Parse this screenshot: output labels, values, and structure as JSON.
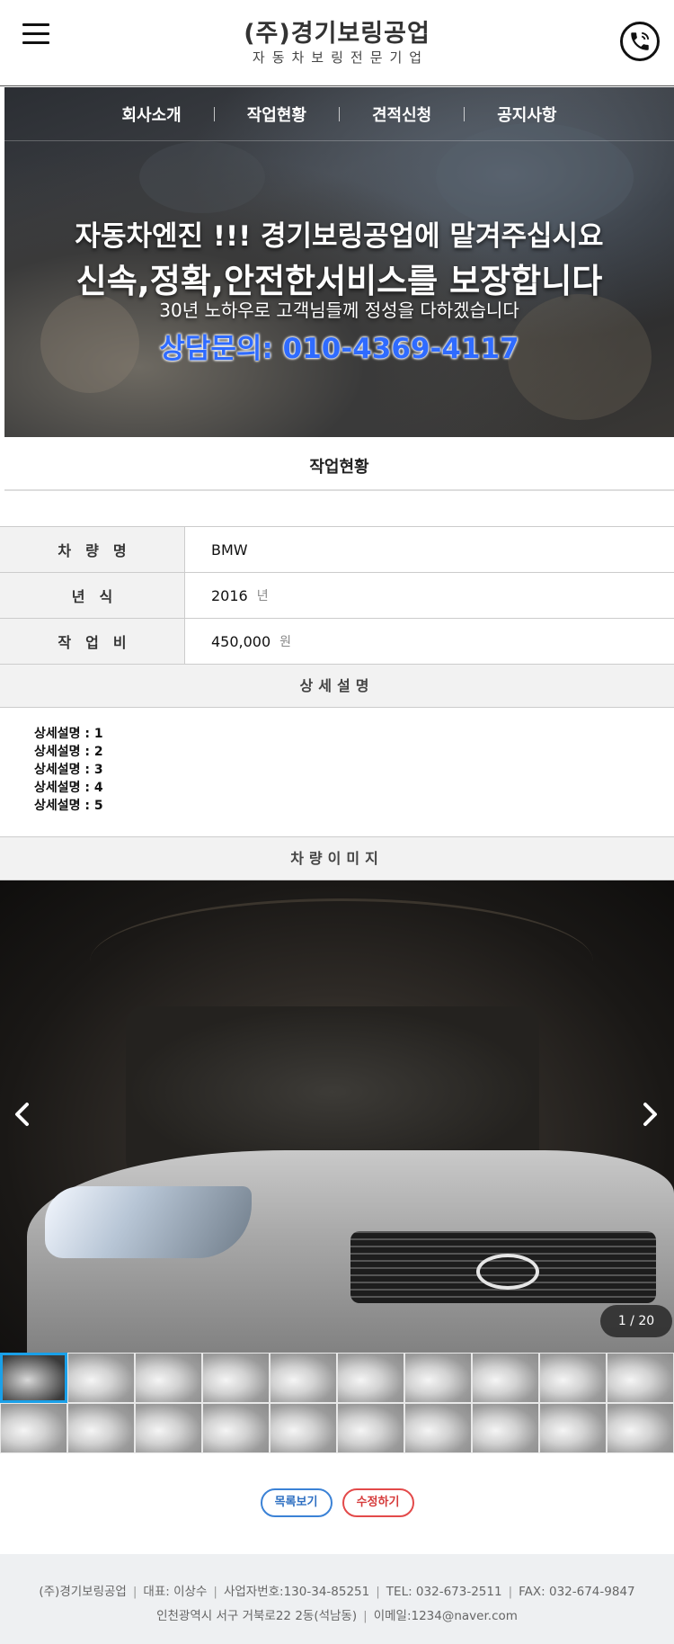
{
  "header": {
    "company": "(주)경기보링공업",
    "tagline": "자동차보링전문기업",
    "menu_icon": "hamburger-icon",
    "call_icon": "phone-call-icon"
  },
  "nav": {
    "items": [
      "회사소개",
      "작업현황",
      "견적신청",
      "공지사항"
    ]
  },
  "hero": {
    "line1": "자동차엔진 !!! 경기보링공업에 맡겨주십시요",
    "line2": "신속,정확,안전한서비스를 보장합니다",
    "line3": "30년 노하우로 고객님들께 정성을 다하겠습니다",
    "contact": "상담문의: 010-4369-4117"
  },
  "page_title": "작업현황",
  "info": {
    "rows": [
      {
        "label": "차량명",
        "value": "BMW",
        "unit": ""
      },
      {
        "label": "년식",
        "value": "2016",
        "unit": "년"
      },
      {
        "label": "작업비",
        "value": "450,000",
        "unit": "원"
      }
    ]
  },
  "detail": {
    "title": "상세설명",
    "lines": [
      "상세설명 : 1",
      "상세설명 : 2",
      "상세설명 : 3",
      "상세설명 : 4",
      "상세설명 : 5"
    ]
  },
  "gallery": {
    "title": "차량이미지",
    "counter": "1 / 20",
    "prev_icon": "chevron-left-icon",
    "next_icon": "chevron-right-icon",
    "thumbnail_count": 20,
    "active_index": 0
  },
  "actions": {
    "list_label": "목록보기",
    "edit_label": "수정하기"
  },
  "footer": {
    "company": "(주)경기보링공업",
    "ceo": "대표: 이상수",
    "biz_no": "사업자번호:130-34-85251",
    "tel": "TEL: 032-673-2511",
    "fax": "FAX: 032-674-9847",
    "address": "인천광역시 서구 거북로22 2동(석남동)",
    "email": "이메일:1234@naver.com"
  },
  "colors": {
    "accent_blue": "#2f6bff",
    "thumb_active": "#1aa0e8",
    "btn_list": "#3b82d6",
    "btn_edit": "#e34a4a"
  }
}
